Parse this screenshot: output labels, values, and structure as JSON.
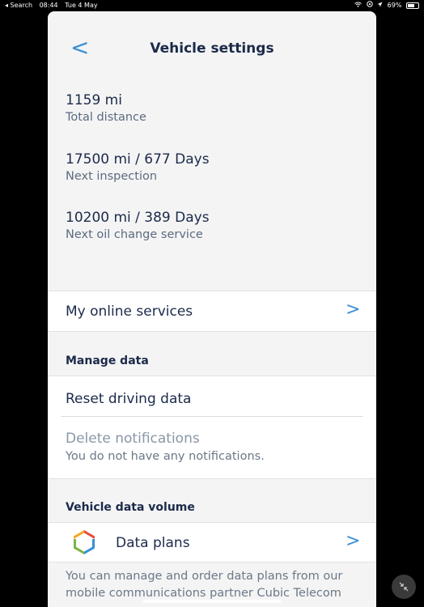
{
  "status_bar": {
    "back_label": "◂ Search",
    "time": "08:44",
    "date": "Tue 4 May",
    "battery": "69%",
    "battery_level": 0.69
  },
  "header": {
    "back_glyph": "<",
    "title": "Vehicle settings"
  },
  "stats": [
    {
      "value": "1159 mi",
      "label": "Total distance"
    },
    {
      "value": "17500 mi / 677 Days",
      "label": "Next inspection"
    },
    {
      "value": "10200 mi / 389 Days",
      "label": "Next oil change service"
    }
  ],
  "online_services": {
    "label": "My online services",
    "chevron": ">"
  },
  "manage_data": {
    "title": "Manage data",
    "reset_label": "Reset driving data",
    "delete_title": "Delete notifications",
    "delete_sub": "You do not have any notifications."
  },
  "data_volume": {
    "title": "Vehicle data volume",
    "plans_label": "Data plans",
    "chevron": ">",
    "description": "You can manage and order data plans from our mobile communications partner Cubic Telecom"
  },
  "colors": {
    "accent": "#3a8fd6",
    "text": "#1b2a4a",
    "background": "#f4f4f4"
  }
}
